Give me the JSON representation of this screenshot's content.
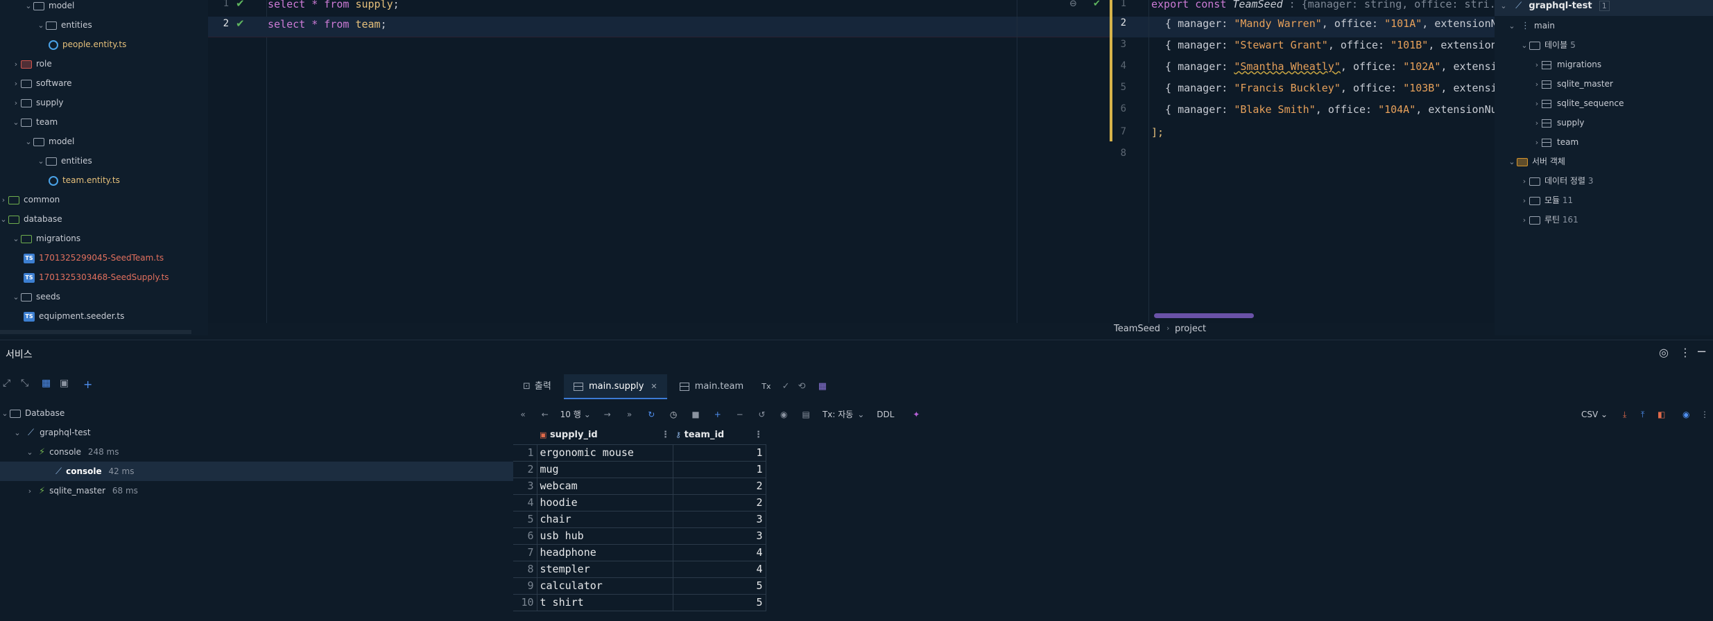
{
  "project_tree": [
    {
      "label": "model",
      "depth": 3,
      "type": "folder",
      "open": true
    },
    {
      "label": "entities",
      "depth": 4,
      "type": "folder",
      "open": true
    },
    {
      "label": "people.entity.ts",
      "depth": 5,
      "type": "entity"
    },
    {
      "label": "role",
      "depth": 2,
      "type": "folder-red",
      "open": false
    },
    {
      "label": "software",
      "depth": 2,
      "type": "folder",
      "open": false
    },
    {
      "label": "supply",
      "depth": 2,
      "type": "folder",
      "open": false
    },
    {
      "label": "team",
      "depth": 2,
      "type": "folder",
      "open": true
    },
    {
      "label": "model",
      "depth": 3,
      "type": "folder",
      "open": true
    },
    {
      "label": "entities",
      "depth": 4,
      "type": "folder",
      "open": true
    },
    {
      "label": "team.entity.ts",
      "depth": 5,
      "type": "entity"
    },
    {
      "label": "common",
      "depth": 1,
      "type": "folder-green",
      "open": false
    },
    {
      "label": "database",
      "depth": 1,
      "type": "folder-green",
      "open": true
    },
    {
      "label": "migrations",
      "depth": 2,
      "type": "folder-green",
      "open": true
    },
    {
      "label": "1701325299045-SeedTeam.ts",
      "depth": 3,
      "type": "ts-red"
    },
    {
      "label": "1701325303468-SeedSupply.ts",
      "depth": 3,
      "type": "ts-red"
    },
    {
      "label": "seeds",
      "depth": 2,
      "type": "folder",
      "open": true
    },
    {
      "label": "equipment.seeder.ts",
      "depth": 3,
      "type": "ts"
    }
  ],
  "editor_sql": {
    "lines": [
      {
        "num": "1",
        "kw1": "select",
        "star": " * ",
        "kw2": "from",
        "table": "supply",
        "end": ";"
      },
      {
        "num": "2",
        "kw1": "select",
        "star": " * ",
        "kw2": "from",
        "table": "team",
        "end": ";"
      }
    ]
  },
  "editor_ts": {
    "line1": {
      "export": "export",
      "const": "const",
      "name": "TeamSeed",
      "type_hint": " : {manager: string, office: stri...",
      "eq": "= "
    },
    "rows": [
      {
        "num": "2",
        "manager": "\"Mandy Warren\"",
        "office": "\"101A\"",
        "tail": "extensionN"
      },
      {
        "num": "3",
        "manager": "\"Stewart Grant\"",
        "office": "\"101B\"",
        "tail": "extension"
      },
      {
        "num": "4",
        "manager": "\"Smantha Wheatly\"",
        "office": "\"102A\"",
        "tail": "extensi"
      },
      {
        "num": "5",
        "manager": "\"Francis Buckley\"",
        "office": "\"103B\"",
        "tail": "extensi"
      },
      {
        "num": "6",
        "manager": "\"Blake Smith\"",
        "office": "\"104A\"",
        "tail": "extensionNu"
      }
    ],
    "closing_num": "7",
    "closing": "];",
    "last_num": "8",
    "line1_num": "1",
    "manager_key": "manager:",
    "office_key": "office:"
  },
  "breadcrumb": {
    "first": "TeamSeed",
    "second": "project"
  },
  "db_tree": {
    "root": "graphql-test",
    "root_badge": "1",
    "schema": "main",
    "tables_label": "테이블",
    "tables_count": "5",
    "tables": [
      "migrations",
      "sqlite_master",
      "sqlite_sequence",
      "supply",
      "team"
    ],
    "server_objects": "서버 객체",
    "groups": [
      {
        "label": "데이터 정렬",
        "count": "3"
      },
      {
        "label": "모듈",
        "count": "11"
      },
      {
        "label": "루틴",
        "count": "161"
      }
    ]
  },
  "services": {
    "title": "서비스",
    "tree": [
      {
        "label": "Database",
        "depth": 0,
        "type": "folder"
      },
      {
        "label": "graphql-test",
        "depth": 1,
        "type": "conn"
      },
      {
        "label": "console",
        "time": "248 ms",
        "depth": 2,
        "type": "console"
      },
      {
        "label": "console",
        "time": "42 ms",
        "depth": 3,
        "type": "console-active"
      },
      {
        "label": "sqlite_master",
        "time": "68 ms",
        "depth": 2,
        "type": "console"
      }
    ]
  },
  "results": {
    "tabs": [
      {
        "label": "출력"
      },
      {
        "label": "main.supply",
        "active": true
      },
      {
        "label": "main.team"
      }
    ],
    "tx": "Tx",
    "page_size": "10 행",
    "tx_mode": "Tx: 자동",
    "ddl": "DDL",
    "export": "CSV",
    "columns": [
      "supply_id",
      "team_id"
    ],
    "rows": [
      {
        "n": "1",
        "name": "ergonomic mouse",
        "team": "1"
      },
      {
        "n": "2",
        "name": "mug",
        "team": "1"
      },
      {
        "n": "3",
        "name": "webcam",
        "team": "2"
      },
      {
        "n": "4",
        "name": "hoodie",
        "team": "2"
      },
      {
        "n": "5",
        "name": "chair",
        "team": "3"
      },
      {
        "n": "6",
        "name": "usb hub",
        "team": "3"
      },
      {
        "n": "7",
        "name": "headphone",
        "team": "4"
      },
      {
        "n": "8",
        "name": "stempler",
        "team": "4"
      },
      {
        "n": "9",
        "name": "calculator",
        "team": "5"
      },
      {
        "n": "10",
        "name": "t shirt",
        "team": "5"
      }
    ]
  }
}
